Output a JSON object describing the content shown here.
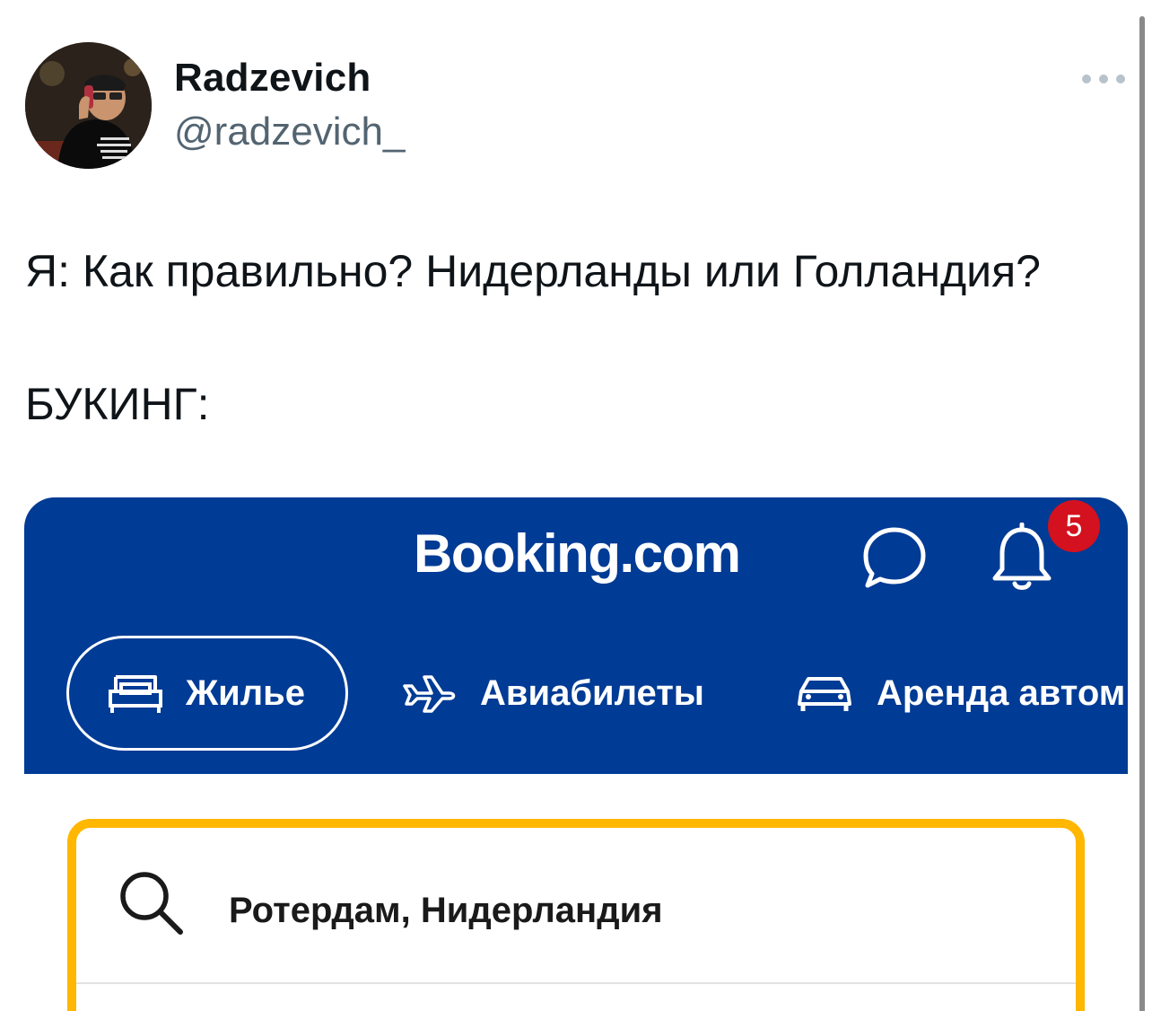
{
  "tweet": {
    "author_name": "Radzevich",
    "author_handle": "@radzevich_",
    "text_line1": "Я: Как правильно? Нидерланды или Голландия?",
    "text_line2": "БУКИНГ:",
    "more_icon": "more-horizontal-icon"
  },
  "booking": {
    "logo": "Booking.com",
    "notification_count": "5",
    "brand_color": "#003b95",
    "highlight_color": "#ffb700",
    "tabs": [
      {
        "label": "Жилье",
        "icon": "bed-icon",
        "selected": true
      },
      {
        "label": "Авиабилеты",
        "icon": "plane-icon",
        "selected": false
      },
      {
        "label": "Аренда автом",
        "icon": "car-icon",
        "selected": false
      }
    ],
    "search": {
      "value": "Ротердам, Нидерландия",
      "icon": "search-icon"
    }
  }
}
